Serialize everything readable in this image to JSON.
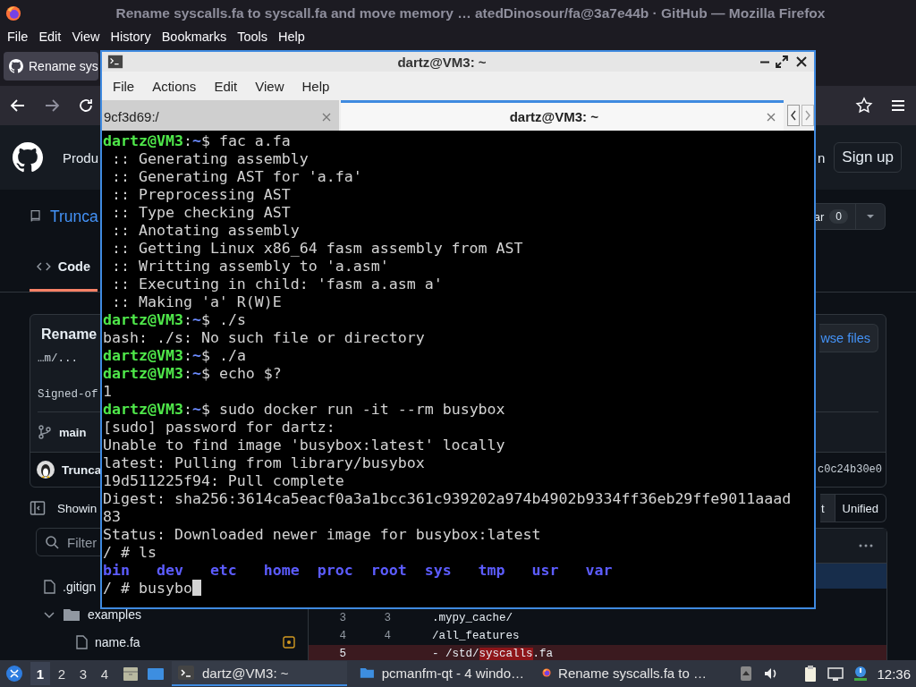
{
  "firefox": {
    "title": "Rename syscalls.fa to syscall.fa and move memory … atedDinosour/fa@3a7e44b · GitHub — Mozilla Firefox",
    "menu": [
      "File",
      "Edit",
      "View",
      "History",
      "Bookmarks",
      "Tools",
      "Help"
    ],
    "tabs": [
      {
        "label": "Rename sys",
        "selected": true
      }
    ]
  },
  "github": {
    "nav": {
      "item": "Produ",
      "sign_in": "n",
      "sign_up": "Sign up"
    },
    "repo": {
      "name": "Trunca",
      "star_label": "ar",
      "star_count": "0"
    },
    "tabs": [
      {
        "label": "Code",
        "selected": true
      }
    ],
    "commit": {
      "title": "Rename",
      "body": "…m/...",
      "signed_off": "Signed-of",
      "branch": "main",
      "author": "Trunca",
      "sha": "c0c24b30e0",
      "browse": "wse files"
    },
    "files_bar": {
      "label": "Showin",
      "views": [
        {
          "label": "t",
          "selected": true
        },
        {
          "label": "Unified",
          "selected": false
        }
      ]
    },
    "sidebar": {
      "filter": {
        "placeholder": "Filter"
      },
      "tree": [
        {
          "name": ".gitign",
          "kind": "file"
        },
        {
          "name": "examples",
          "kind": "folder",
          "expanded": true,
          "children": [
            {
              "name": "name.fa",
              "kind": "file",
              "modified": true
            }
          ]
        }
      ]
    },
    "diff": {
      "rows": [
        {
          "old": "3",
          "new": "3",
          "kind": "context",
          "code": [
            {
              "text": ".mypy_cache/",
              "highlight": false
            }
          ]
        },
        {
          "old": "4",
          "new": "4",
          "kind": "context",
          "code": [
            {
              "text": "/all_features",
              "highlight": false
            }
          ]
        },
        {
          "old": "5",
          "new": "",
          "kind": "deletion",
          "code": [
            {
              "text": "- /std/",
              "highlight": false
            },
            {
              "text": "syscalls",
              "highlight": true
            },
            {
              "text": ".fa",
              "highlight": false
            }
          ]
        }
      ]
    }
  },
  "terminal": {
    "title": "dartz@VM3: ~",
    "menu": [
      "File",
      "Actions",
      "Edit",
      "View",
      "Help"
    ],
    "tabs": [
      {
        "label": "9cf3d69:/",
        "selected": false
      },
      {
        "label": "dartz@VM3: ~",
        "selected": true
      }
    ],
    "lines": [
      {
        "segments": [
          {
            "kind": "user",
            "text": "dartz@VM3"
          },
          {
            "kind": "plain",
            "text": ":"
          },
          {
            "kind": "path",
            "text": "~"
          },
          {
            "kind": "plain",
            "text": "$ fac a.fa"
          }
        ]
      },
      {
        "segments": [
          {
            "kind": "plain",
            "text": " :: Generating assembly"
          }
        ]
      },
      {
        "segments": [
          {
            "kind": "plain",
            "text": " :: Generating AST for 'a.fa'"
          }
        ]
      },
      {
        "segments": [
          {
            "kind": "plain",
            "text": " :: Preprocessing AST"
          }
        ]
      },
      {
        "segments": [
          {
            "kind": "plain",
            "text": " :: Type checking AST"
          }
        ]
      },
      {
        "segments": [
          {
            "kind": "plain",
            "text": " :: Anotating assembly"
          }
        ]
      },
      {
        "segments": [
          {
            "kind": "plain",
            "text": " :: Getting Linux x86_64 fasm assembly from AST"
          }
        ]
      },
      {
        "segments": [
          {
            "kind": "plain",
            "text": " :: Writting assembly to 'a.asm'"
          }
        ]
      },
      {
        "segments": [
          {
            "kind": "plain",
            "text": " :: Executing in child: 'fasm a.asm a'"
          }
        ]
      },
      {
        "segments": [
          {
            "kind": "plain",
            "text": " :: Making 'a' R(W)E"
          }
        ]
      },
      {
        "segments": [
          {
            "kind": "user",
            "text": "dartz@VM3"
          },
          {
            "kind": "plain",
            "text": ":"
          },
          {
            "kind": "path",
            "text": "~"
          },
          {
            "kind": "plain",
            "text": "$ ./s"
          }
        ]
      },
      {
        "segments": [
          {
            "kind": "plain",
            "text": "bash: ./s: No such file or directory"
          }
        ]
      },
      {
        "segments": [
          {
            "kind": "user",
            "text": "dartz@VM3"
          },
          {
            "kind": "plain",
            "text": ":"
          },
          {
            "kind": "path",
            "text": "~"
          },
          {
            "kind": "plain",
            "text": "$ ./a"
          }
        ]
      },
      {
        "segments": [
          {
            "kind": "user",
            "text": "dartz@VM3"
          },
          {
            "kind": "plain",
            "text": ":"
          },
          {
            "kind": "path",
            "text": "~"
          },
          {
            "kind": "plain",
            "text": "$ echo $?"
          }
        ]
      },
      {
        "segments": [
          {
            "kind": "plain",
            "text": "1"
          }
        ]
      },
      {
        "segments": [
          {
            "kind": "user",
            "text": "dartz@VM3"
          },
          {
            "kind": "plain",
            "text": ":"
          },
          {
            "kind": "path",
            "text": "~"
          },
          {
            "kind": "plain",
            "text": "$ sudo docker run -it --rm busybox"
          }
        ]
      },
      {
        "segments": [
          {
            "kind": "plain",
            "text": "[sudo] password for dartz:"
          }
        ]
      },
      {
        "segments": [
          {
            "kind": "plain",
            "text": "Unable to find image 'busybox:latest' locally"
          }
        ]
      },
      {
        "segments": [
          {
            "kind": "plain",
            "text": "latest: Pulling from library/busybox"
          }
        ]
      },
      {
        "segments": [
          {
            "kind": "plain",
            "text": "19d511225f94: Pull complete"
          }
        ]
      },
      {
        "segments": [
          {
            "kind": "plain",
            "text": "Digest: sha256:3614ca5eacf0a3a1bcc361c939202a974b4902b9334ff36eb29ffe9011aaad"
          }
        ]
      },
      {
        "segments": [
          {
            "kind": "plain",
            "text": "83"
          }
        ]
      },
      {
        "segments": [
          {
            "kind": "plain",
            "text": "Status: Downloaded newer image for busybox:latest"
          }
        ]
      },
      {
        "segments": [
          {
            "kind": "plain",
            "text": "/ # ls"
          }
        ]
      },
      {
        "segments": [
          {
            "kind": "dir",
            "text": "bin   dev   etc   home  proc  root  sys   tmp   usr   var"
          }
        ]
      },
      {
        "segments": [
          {
            "kind": "plain",
            "text": "/ # busybo"
          }
        ],
        "cursor": true
      }
    ]
  },
  "taskbar": {
    "workspaces": [
      {
        "label": "1",
        "selected": true
      },
      {
        "label": "2",
        "selected": false
      },
      {
        "label": "3",
        "selected": false
      },
      {
        "label": "4",
        "selected": false
      }
    ],
    "tasks": [
      {
        "label": "dartz@VM3: ~",
        "kind": "terminal",
        "selected": true
      },
      {
        "label": "pcmanfm-qt - 4 windo…",
        "kind": "folder",
        "selected": false
      },
      {
        "label": "Rename syscalls.fa to …",
        "kind": "firefox",
        "selected": false
      }
    ],
    "clock": "12:36"
  }
}
